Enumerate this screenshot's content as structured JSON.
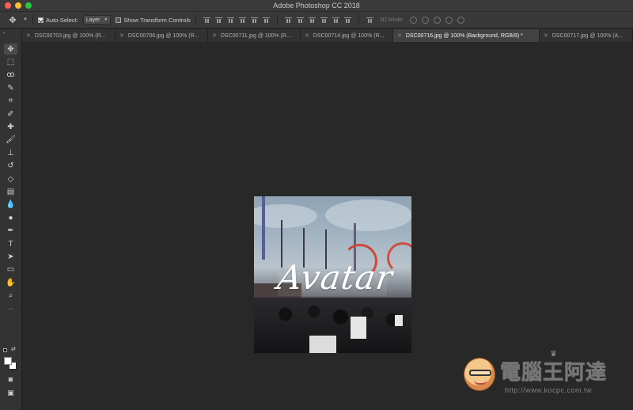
{
  "window": {
    "title": "Adobe Photoshop CC 2018"
  },
  "options": {
    "auto_select_label": "Auto-Select:",
    "auto_select_value": "Layer",
    "show_transform_label": "Show Transform Controls",
    "mode_3d_label": "3D Mode:"
  },
  "tabs": [
    {
      "label": "DSC00703.jpg @ 100% (R...",
      "active": false
    },
    {
      "label": "DSC00706.jpg @ 100% (R...",
      "active": false
    },
    {
      "label": "DSC00711.jpg @ 100% (R...",
      "active": false
    },
    {
      "label": "DSC00714.jpg @ 100% (R...",
      "active": false
    },
    {
      "label": "DSC00716.jpg @ 100% (Background, RGB/8) *",
      "active": true
    },
    {
      "label": "DSC00717.jpg @ 100% (A...",
      "active": false
    }
  ],
  "tools": [
    {
      "name": "move-tool-icon",
      "glyph": "✥"
    },
    {
      "name": "marquee-tool-icon",
      "glyph": "⬚"
    },
    {
      "name": "lasso-tool-icon",
      "glyph": "ꝏ"
    },
    {
      "name": "quick-select-tool-icon",
      "glyph": "✎"
    },
    {
      "name": "crop-tool-icon",
      "glyph": "⌗"
    },
    {
      "name": "eyedropper-tool-icon",
      "glyph": "✐"
    },
    {
      "name": "healing-brush-tool-icon",
      "glyph": "✚"
    },
    {
      "name": "brush-tool-icon",
      "glyph": "🖌"
    },
    {
      "name": "clone-stamp-tool-icon",
      "glyph": "⊥"
    },
    {
      "name": "history-brush-tool-icon",
      "glyph": "↺"
    },
    {
      "name": "eraser-tool-icon",
      "glyph": "◇"
    },
    {
      "name": "gradient-tool-icon",
      "glyph": "▤"
    },
    {
      "name": "blur-tool-icon",
      "glyph": "💧"
    },
    {
      "name": "dodge-tool-icon",
      "glyph": "●"
    },
    {
      "name": "pen-tool-icon",
      "glyph": "✒"
    },
    {
      "name": "type-tool-icon",
      "glyph": "T"
    },
    {
      "name": "path-select-tool-icon",
      "glyph": "➤"
    },
    {
      "name": "rectangle-tool-icon",
      "glyph": "▭"
    },
    {
      "name": "hand-tool-icon",
      "glyph": "✋"
    },
    {
      "name": "zoom-tool-icon",
      "glyph": "⌕"
    },
    {
      "name": "more-tools-icon",
      "glyph": "···"
    }
  ],
  "bottom_tools": [
    {
      "name": "quick-mask-icon",
      "glyph": "◙"
    },
    {
      "name": "screen-mode-icon",
      "glyph": "▣"
    }
  ],
  "document": {
    "overlay_text": "Avatar"
  },
  "watermark": {
    "title": "電腦王阿達",
    "url": "http://www.kocpc.com.tw"
  }
}
